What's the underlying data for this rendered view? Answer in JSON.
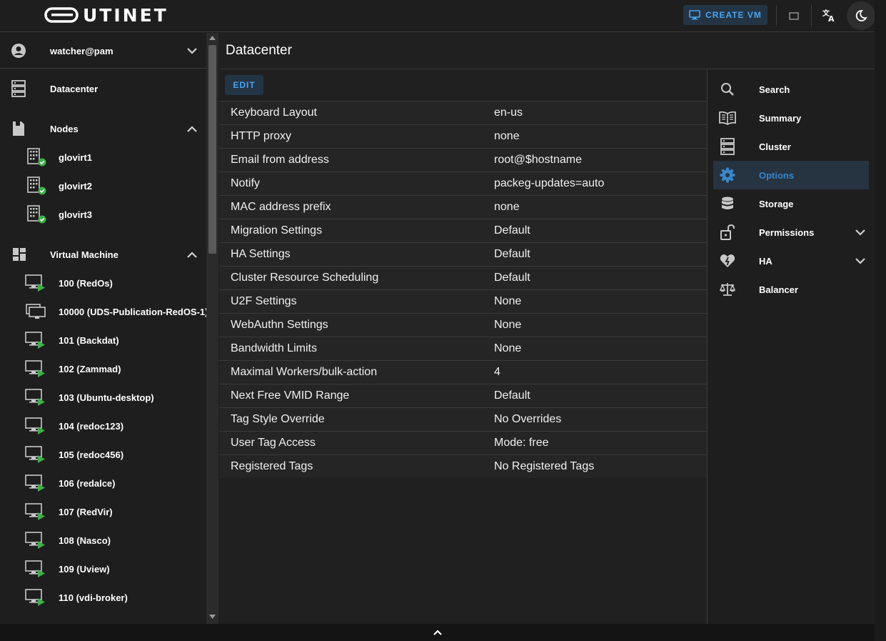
{
  "app": {
    "logo_text": "UTINET"
  },
  "topbar": {
    "create_vm_label": "CREATE VM"
  },
  "user": {
    "name": "watcher@pam"
  },
  "sidebar": {
    "datacenter_label": "Datacenter",
    "nodes_label": "Nodes",
    "nodes": [
      "glovirt1",
      "glovirt2",
      "glovirt3"
    ],
    "vm_section_label": "Virtual Machine",
    "vms": [
      "100 (RedOs)",
      "10000 (UDS-Publication-RedOS-1)",
      "101 (Backdat)",
      "102 (Zammad)",
      "103 (Ubuntu-desktop)",
      "104 (redoc123)",
      "105 (redoc456)",
      "106 (redalce)",
      "107 (RedVir)",
      "108 (Nasco)",
      "109 (Uview)",
      "110 (vdi-broker)"
    ]
  },
  "main": {
    "title": "Datacenter",
    "edit_label": "EDIT",
    "options": [
      {
        "name": "Keyboard Layout",
        "value": "en-us"
      },
      {
        "name": "HTTP proxy",
        "value": "none"
      },
      {
        "name": "Email from address",
        "value": "root@$hostname"
      },
      {
        "name": "Notify",
        "value": "packeg-updates=auto"
      },
      {
        "name": "MAC address prefix",
        "value": "none"
      },
      {
        "name": "Migration Settings",
        "value": "Default"
      },
      {
        "name": "HA Settings",
        "value": "Default"
      },
      {
        "name": "Cluster Resource Scheduling",
        "value": "Default"
      },
      {
        "name": "U2F Settings",
        "value": "None"
      },
      {
        "name": "WebAuthn Settings",
        "value": "None"
      },
      {
        "name": "Bandwidth Limits",
        "value": "None"
      },
      {
        "name": "Maximal Workers/bulk-action",
        "value": "4"
      },
      {
        "name": "Next Free VMID Range",
        "value": "Default"
      },
      {
        "name": "Tag Style Override",
        "value": "No Overrides"
      },
      {
        "name": "User Tag Access",
        "value": "Mode: free"
      },
      {
        "name": "Registered Tags",
        "value": "No Registered Tags"
      }
    ]
  },
  "right_menu": {
    "items": [
      {
        "label": "Search",
        "icon": "search-icon"
      },
      {
        "label": "Summary",
        "icon": "book-icon"
      },
      {
        "label": "Cluster",
        "icon": "server-icon"
      },
      {
        "label": "Options",
        "icon": "gear-icon",
        "active": true
      },
      {
        "label": "Storage",
        "icon": "database-icon"
      },
      {
        "label": "Permissions",
        "icon": "lock-open-icon"
      },
      {
        "label": "HA",
        "icon": "heart-pulse-icon"
      },
      {
        "label": "Balancer",
        "icon": "scale-icon"
      }
    ]
  },
  "colors": {
    "accent": "#4aa3f0",
    "active_bg": "#263341",
    "status_ok": "#3fae49",
    "vm_running": "#3fae49"
  }
}
